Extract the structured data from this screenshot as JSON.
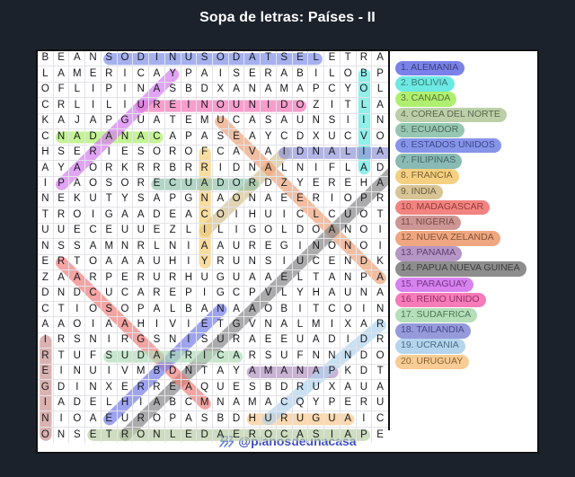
{
  "page": {
    "title": "Sopa de letras: Países - II",
    "background_color": "#1b222c"
  },
  "footer": {
    "handle": "@planosdeunacasa",
    "icon": "waves-icon",
    "handle_color": "#3f4fc4"
  },
  "grid": {
    "rows": 25,
    "cols": 22,
    "letters": [
      "BEANSODINUSODATSELETRAS",
      "LAMERICAYPAISERABILOBPR",
      "OFLIPINASBDXANAMAPCYOLE",
      "CRLILIUREINOUNIDOZITLAN",
      "KAJAPGUATEMUCASAUNSIINO",
      "CNADANACAPASEAYCDXUCVOU",
      "HSERIESOROFCAVAIDNALIAT",
      "AYAORKRRBRRIDNALNIFLADP",
      "IPAOSORECUADORDZYEREHAL",
      "NEKUTYSAPGNAONAEERIOPRA",
      "TROIGAADEACOIHUICLCUOTT",
      "UUECEUUEZLILIGOLDOANOIA",
      "NSSAMNRLNIAAUREGINONOIS",
      "ERTOAAAUHIYRUNSIUCENDKA",
      "ZAARPERURHUGUAAELTANPAN",
      "DNDCUCAREPIGCPVLYHAUNAI",
      "CTIOSOPALBANAAOBITCOINP",
      "AAOIAAHIVIETGVNALMIXARI",
      "IRSNIRGSNISURAEEUADIDRL",
      "RTUFSUDAFRICARSUFNNNDOI",
      "EINUIVMBDNTAYAMANAPKDTF",
      "GDINXERREAQUESBDRUXAUAG",
      "IADELHIABCMNAMACQYPERUN",
      "NIOAEUROPASBDHURUGUAICI",
      "ONSETRONLEDAEROCASIAPEK"
    ]
  },
  "word_list": [
    {
      "number": "1.",
      "word": "ALEMANIA",
      "label": "1. ALEMANIA",
      "color": "#6f78e8",
      "text_color": "#2a2f6e"
    },
    {
      "number": "2.",
      "word": "BOLIVIA",
      "label": "2. BOLIVIA",
      "color": "#5fe8e0",
      "text_color": "#2a6b67"
    },
    {
      "number": "3.",
      "word": "CANADA",
      "label": "3. CANADA",
      "color": "#a9ee63",
      "text_color": "#4d6b26"
    },
    {
      "number": "4.",
      "word": "COREA DEL NORTE",
      "label": "4. COREA DEL NORTE",
      "color": "#b7cca1",
      "text_color": "#4d5b3e"
    },
    {
      "number": "5.",
      "word": "ECUADOR",
      "label": "5. ECUADOR",
      "color": "#8fc3ac",
      "text_color": "#3d5d4e"
    },
    {
      "number": "6.",
      "word": "ESTADOS UNIDOS",
      "label": "6. ESTADOS UNIDOS",
      "color": "#7c8ce8",
      "text_color": "#2f3a80"
    },
    {
      "number": "7.",
      "word": "FILIPINAS",
      "label": "7. FILIPINAS",
      "color": "#7fb5ae",
      "text_color": "#36585a"
    },
    {
      "number": "8.",
      "word": "FRANCIA",
      "label": "8. FRANCIA",
      "color": "#f5cd76",
      "text_color": "#6d5420"
    },
    {
      "number": "9.",
      "word": "INDIA",
      "label": "9. INDIA",
      "color": "#d5c08d",
      "text_color": "#5e5230"
    },
    {
      "number": "10.",
      "word": "MADAGASCAR",
      "label": "10. MADAGASCAR",
      "color": "#f07a77",
      "text_color": "#8d2b2c"
    },
    {
      "number": "11.",
      "word": "NIGERIA",
      "label": "11. NIGERIA",
      "color": "#c98e8b",
      "text_color": "#6d3a38"
    },
    {
      "number": "12.",
      "word": "NUEVA ZELANDA",
      "label": "12. NUEVA ZELANDA",
      "color": "#eda077",
      "text_color": "#7d4424"
    },
    {
      "number": "13.",
      "word": "PANAMA",
      "label": "13. PANAMA",
      "color": "#b08ec0",
      "text_color": "#513065"
    },
    {
      "number": "14.",
      "word": "PAPUA NUEVA GUINEA",
      "label": "14. PAPUA NUEVA GUINEA",
      "color": "#848484",
      "text_color": "#2e2e2e"
    },
    {
      "number": "15.",
      "word": "PARAGUAY",
      "label": "15. PARAGUAY",
      "color": "#d478ee",
      "text_color": "#6b2480"
    },
    {
      "number": "16.",
      "word": "REINO UNIDO",
      "label": "16. REINO UNIDO",
      "color": "#f670b4",
      "text_color": "#8a2159"
    },
    {
      "number": "17.",
      "word": "SUDAFRICA",
      "label": "17. SUDAFRICA",
      "color": "#aeddb4",
      "text_color": "#416b48"
    },
    {
      "number": "18.",
      "word": "TAILANDIA",
      "label": "18. TAILANDIA",
      "color": "#8e92d8",
      "text_color": "#383b7e"
    },
    {
      "number": "19.",
      "word": "UCRANIA",
      "label": "19. UCRANIA",
      "color": "#afd2ec",
      "text_color": "#3f5f7c"
    },
    {
      "number": "20.",
      "word": "URUGUAY",
      "label": "20. URUGUAY",
      "color": "#f8c88c",
      "text_color": "#7d5526"
    }
  ],
  "highlights": [
    {
      "word": "ESTADOS UNIDOS",
      "color": "#7c8ce8",
      "r1": 0,
      "c1": 4,
      "r2": 0,
      "c2": 17
    },
    {
      "word": "BOLIVIA",
      "color": "#5fe8e0",
      "r1": 1,
      "c1": 20,
      "r2": 7,
      "c2": 20
    },
    {
      "word": "CANADA",
      "color": "#a9ee63",
      "r1": 5,
      "c1": 1,
      "r2": 5,
      "c2": 7
    },
    {
      "word": "REINO UNIDO",
      "color": "#f670b4",
      "r1": 3,
      "c1": 6,
      "r2": 3,
      "c2": 16
    },
    {
      "word": "PARAGUAY",
      "color": "#d478ee",
      "r1": 8,
      "c1": 1,
      "r2": 1,
      "c2": 8
    },
    {
      "word": "INDIA",
      "color": "#d5c08d",
      "r1": 6,
      "c1": 15,
      "r2": 11,
      "c2": 10
    },
    {
      "word": "TAILANDIA",
      "color": "#8e92d8",
      "r1": 6,
      "c1": 15,
      "r2": 6,
      "c2": 22
    },
    {
      "word": "FRANCIA",
      "color": "#f5cd76",
      "r1": 6,
      "c1": 10,
      "r2": 13,
      "c2": 10
    },
    {
      "word": "ECUADOR",
      "color": "#8fc3ac",
      "r1": 8,
      "c1": 7,
      "r2": 8,
      "c2": 13
    },
    {
      "word": "NIGERIA",
      "color": "#c98e8b",
      "r1": 18,
      "c1": 0,
      "r2": 24,
      "c2": 0
    },
    {
      "word": "NUEVA ZELANDA",
      "color": "#eda077",
      "r1": 4,
      "c1": 11,
      "r2": 14,
      "c2": 21
    },
    {
      "word": "PAPUA NUEVA GUINEA",
      "color": "#848484",
      "r1": 7,
      "c1": 22,
      "r2": 24,
      "c2": 5
    },
    {
      "word": "MADAGASCAR",
      "color": "#f07a77",
      "r1": 13,
      "c1": 1,
      "r2": 22,
      "c2": 10
    },
    {
      "word": "FILIPINAS",
      "color": "#7fb5ae",
      "r1": 12,
      "c1": 22,
      "r2": 20,
      "c2": 22
    },
    {
      "word": "ALEMANIA",
      "color": "#6f78e8",
      "r1": 16,
      "c1": 11,
      "r2": 23,
      "c2": 4
    },
    {
      "word": "SUDAFRICA",
      "color": "#aeddb4",
      "r1": 19,
      "c1": 4,
      "r2": 19,
      "c2": 12
    },
    {
      "word": "PANAMA",
      "color": "#b08ec0",
      "r1": 20,
      "c1": 13,
      "r2": 20,
      "c2": 18
    },
    {
      "word": "URUGUAY",
      "color": "#f8c88c",
      "r1": 23,
      "c1": 13,
      "r2": 23,
      "c2": 19
    },
    {
      "word": "UCRANIA",
      "color": "#afd2ec",
      "r1": 17,
      "c1": 21,
      "r2": 23,
      "c2": 14
    },
    {
      "word": "COREA DEL NORTE",
      "color": "#b7cca1",
      "r1": 24,
      "c1": 20,
      "r2": 24,
      "c2": 3
    }
  ]
}
